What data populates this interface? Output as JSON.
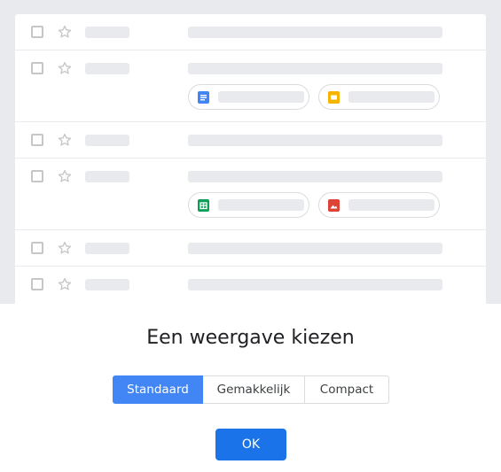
{
  "dialog": {
    "title": "Een weergave kiezen",
    "density_options": [
      {
        "label": "Standaard",
        "selected": true
      },
      {
        "label": "Gemakkelijk",
        "selected": false
      },
      {
        "label": "Compact",
        "selected": false
      }
    ],
    "ok_label": "OK"
  },
  "preview": {
    "rows": [
      {
        "attachments": []
      },
      {
        "attachments": [
          "docs-icon",
          "slides-icon"
        ]
      },
      {
        "attachments": []
      },
      {
        "attachments": [
          "sheets-icon",
          "image-icon"
        ]
      },
      {
        "attachments": []
      },
      {
        "attachments": []
      }
    ]
  },
  "colors": {
    "accent": "#1a73e8",
    "selected_segment": "#4285f4",
    "docs": "#4285f4",
    "slides": "#f4b400",
    "sheets": "#0f9d58",
    "image": "#db4437",
    "placeholder": "#e8eaed"
  }
}
